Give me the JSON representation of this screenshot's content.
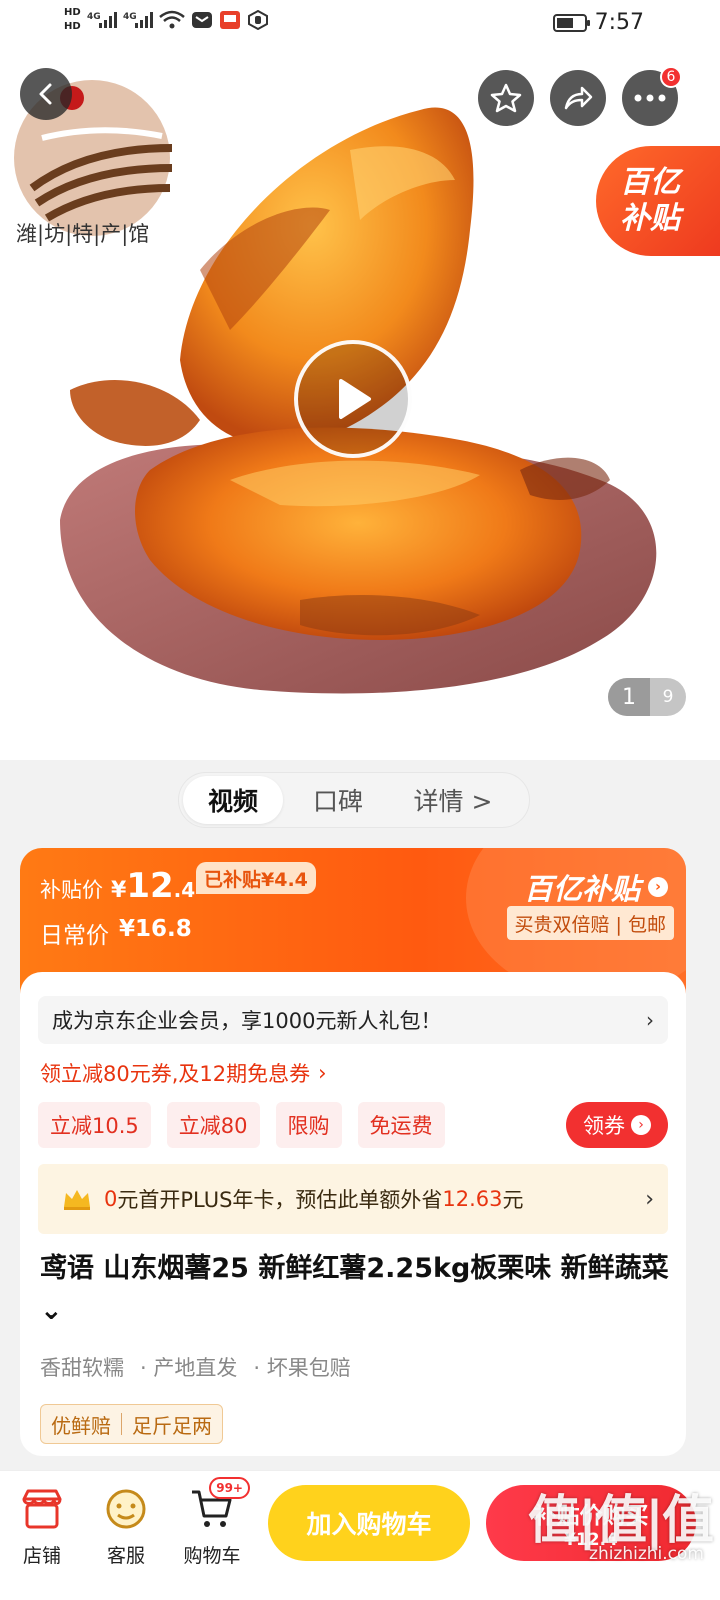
{
  "status_bar": {
    "hd1": "HD",
    "hd2": "HD",
    "net1": "4G",
    "net2": "4G",
    "time": "7:57"
  },
  "header": {
    "back_icon": "chevron-left-icon",
    "favorite_icon": "star-icon",
    "share_icon": "share-arrow-icon",
    "more_icon": "more-dots-icon",
    "more_badge": "6"
  },
  "store": {
    "logo_text": "潍|坊|特|产|馆"
  },
  "subsidy_tag": {
    "line1": "百亿",
    "line2": "补贴"
  },
  "gallery": {
    "current": "1",
    "total": "9",
    "play_icon": "play-icon"
  },
  "tabs": [
    {
      "label": "视频",
      "active": true
    },
    {
      "label": "口碑",
      "active": false
    },
    {
      "label": "详情 >",
      "active": false
    }
  ],
  "price": {
    "subsidy_label": "补贴价",
    "currency": "¥",
    "integer": "12",
    "decimal": ".4",
    "subsidized_badge": "已补贴¥4.4",
    "regular_label": "日常价",
    "regular_price": "¥16.8",
    "brand": "百亿补贴",
    "guarantee": "买贵双倍赔 | 包邮",
    "accent": "#ff5a10"
  },
  "promo": {
    "member_text": "成为京东企业会员，享1000元新人礼包！",
    "member_chevron": "›",
    "coupon_line": "领立减80元券,及12期免息券",
    "coupon_chevron": "›",
    "tags": [
      "立减10.5",
      "立减80",
      "限购",
      "免运费"
    ],
    "get_coupon": "领券",
    "plus_prefix": "0",
    "plus_mid": "元首开PLUS年卡，预估此单额外省",
    "plus_amount": "12.63",
    "plus_suffix": "元",
    "plus_chevron": "›"
  },
  "product": {
    "title": "鸢语 山东烟薯25 新鲜红薯2.25kg板栗味 新鲜蔬菜 ⌄",
    "features": [
      "香甜软糯",
      "· 产地直发",
      "· 坏果包赔"
    ],
    "assurance": [
      "优鲜赔",
      "足斤足两"
    ]
  },
  "bottom_bar": {
    "shop": "店铺",
    "service": "客服",
    "cart": "购物车",
    "cart_badge": "99+",
    "add_to_cart": "加入购物车",
    "buy_label": "补贴价购买",
    "buy_price": "¥12.4",
    "cart_button_color": "#ffd21c",
    "buy_button_color": "#f02a30"
  },
  "watermark": {
    "text": "值|值|值",
    "url": "zhizhizhi.com"
  }
}
